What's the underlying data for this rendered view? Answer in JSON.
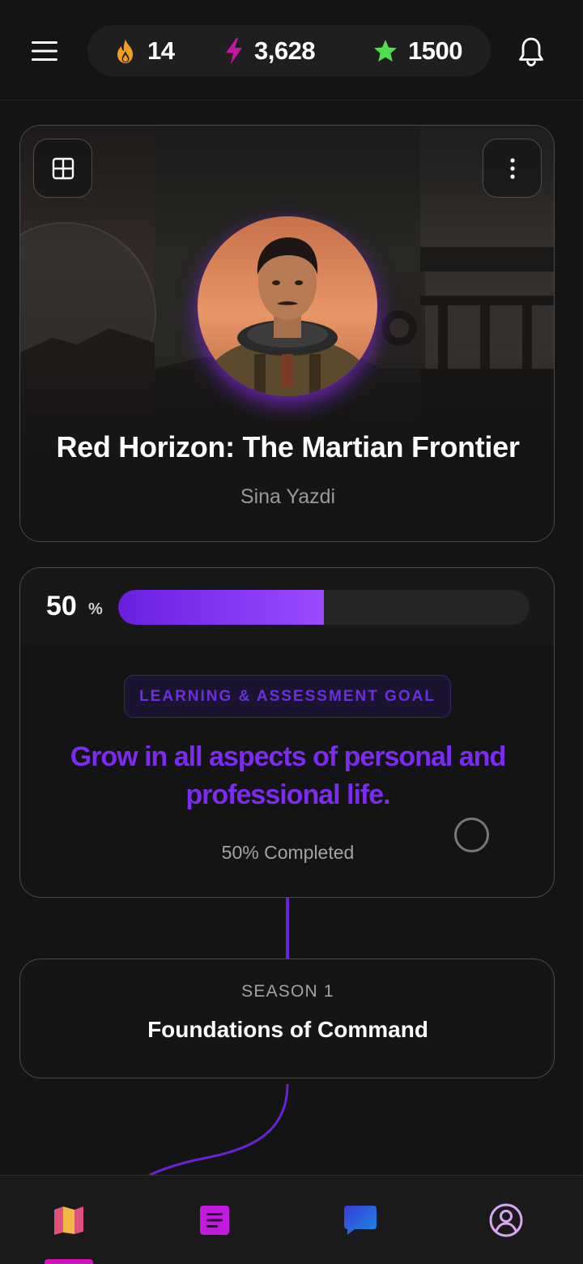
{
  "header": {
    "stats": [
      {
        "icon": "flame-icon",
        "value": "14",
        "color": "#f59e1b"
      },
      {
        "icon": "lightning-icon",
        "value": "3,628",
        "color": "#c0189e"
      },
      {
        "icon": "star-icon",
        "value": "1500",
        "color": "#4ee04e"
      }
    ]
  },
  "hero": {
    "title": "Red Horizon: The Martian Frontier",
    "author": "Sina Yazdi"
  },
  "progress": {
    "value": "50",
    "unit": "%",
    "fraction": 0.5
  },
  "goal": {
    "badge": "LEARNING & ASSESSMENT GOAL",
    "text": "Grow in all aspects of personal and professional life.",
    "status": "50% Completed"
  },
  "season": {
    "label": "SEASON 1",
    "title": "Foundations of Command"
  },
  "nav": {
    "items": [
      {
        "icon": "map-icon",
        "active": true
      },
      {
        "icon": "document-icon",
        "active": false
      },
      {
        "icon": "chat-icon",
        "active": false
      },
      {
        "icon": "profile-icon",
        "active": false
      }
    ]
  },
  "colors": {
    "accent": "#7b2cf0",
    "nav_indicator": "#d016b8",
    "background": "#141414"
  }
}
